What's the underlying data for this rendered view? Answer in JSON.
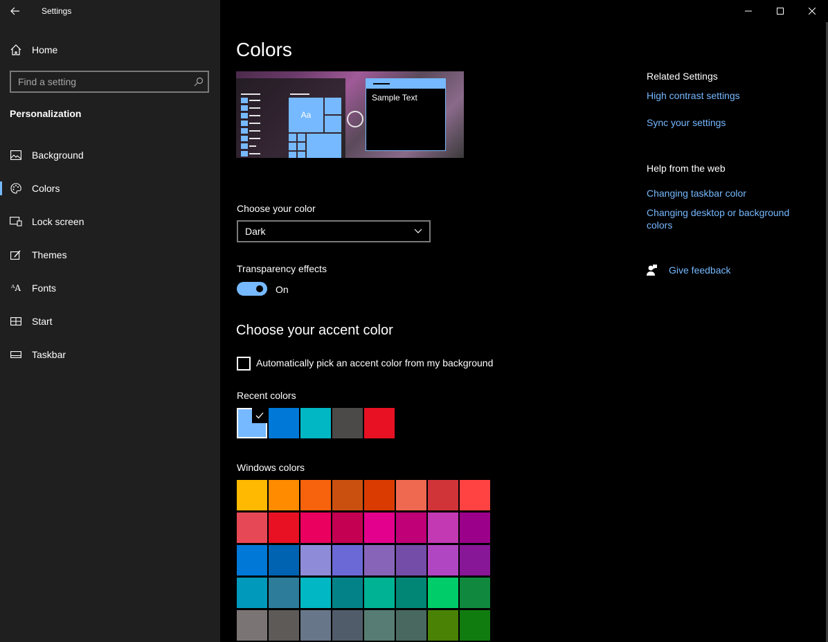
{
  "app": {
    "title": "Settings"
  },
  "sidebar": {
    "home_label": "Home",
    "search_placeholder": "Find a setting",
    "section_title": "Personalization",
    "items": [
      {
        "label": "Background",
        "icon": "picture-icon"
      },
      {
        "label": "Colors",
        "icon": "palette-icon",
        "active": true
      },
      {
        "label": "Lock screen",
        "icon": "lock-screen-icon"
      },
      {
        "label": "Themes",
        "icon": "themes-icon"
      },
      {
        "label": "Fonts",
        "icon": "fonts-icon"
      },
      {
        "label": "Start",
        "icon": "start-icon"
      },
      {
        "label": "Taskbar",
        "icon": "taskbar-icon"
      }
    ]
  },
  "main": {
    "title": "Colors",
    "preview": {
      "tile_text": "Aa",
      "sample_text": "Sample Text"
    },
    "choose_color_label": "Choose your color",
    "choose_color_value": "Dark",
    "transparency_label": "Transparency effects",
    "transparency_state": "On",
    "accent_heading": "Choose your accent color",
    "auto_pick_label": "Automatically pick an accent color from my background",
    "recent_label": "Recent colors",
    "recent_colors": [
      "#76b9ff",
      "#0078d7",
      "#00b7c3",
      "#4c4a48",
      "#e81123"
    ],
    "windows_label": "Windows colors",
    "windows_colors": [
      [
        "#ffb900",
        "#ff8c00",
        "#f7630c",
        "#ca5010",
        "#da3b01",
        "#ef6950",
        "#d13438",
        "#ff4343"
      ],
      [
        "#e74856",
        "#e81123",
        "#ea005e",
        "#c30052",
        "#e3008c",
        "#bf0077",
        "#c239b3",
        "#9a0089"
      ],
      [
        "#0078d7",
        "#0063b1",
        "#8e8cd8",
        "#6b69d6",
        "#8764b8",
        "#744da9",
        "#b146c2",
        "#881798"
      ],
      [
        "#0099bc",
        "#2d7d9a",
        "#00b7c3",
        "#038387",
        "#00b294",
        "#018574",
        "#00cc6a",
        "#10893e"
      ],
      [
        "#7a7574",
        "#5d5a58",
        "#68768a",
        "#515c6b",
        "#567c73",
        "#486860",
        "#498205",
        "#107c10"
      ]
    ]
  },
  "right": {
    "related_heading": "Related Settings",
    "related_links": [
      "High contrast settings",
      "Sync your settings"
    ],
    "help_heading": "Help from the web",
    "help_links": [
      "Changing taskbar color",
      "Changing desktop or background colors"
    ],
    "feedback_label": "Give feedback"
  },
  "colors": {
    "accent": "#76b9ff",
    "sidebar_bg": "#1f1f1f",
    "content_bg": "#000000"
  }
}
